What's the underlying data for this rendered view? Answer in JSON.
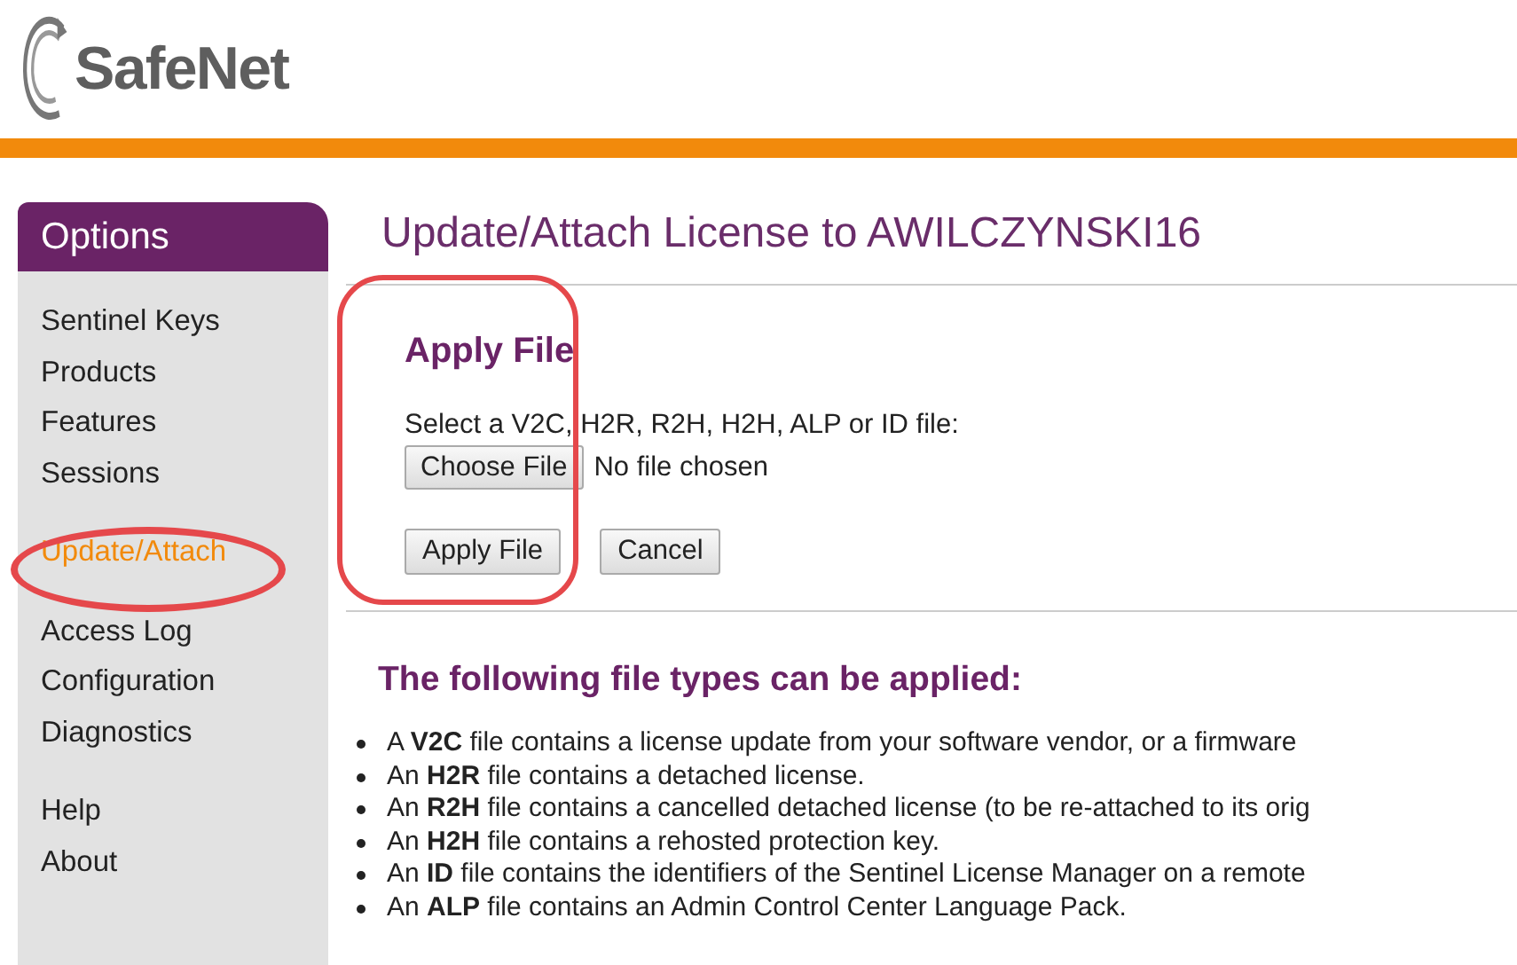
{
  "logo": {
    "text": "SafeNet"
  },
  "sidebar": {
    "title": "Options",
    "groups": [
      [
        {
          "label": "Sentinel Keys",
          "selected": false
        },
        {
          "label": "Products",
          "selected": false
        },
        {
          "label": "Features",
          "selected": false
        },
        {
          "label": "Sessions",
          "selected": false
        }
      ],
      [
        {
          "label": "Update/Attach",
          "selected": true
        }
      ],
      [
        {
          "label": "Access Log",
          "selected": false
        },
        {
          "label": "Configuration",
          "selected": false
        },
        {
          "label": "Diagnostics",
          "selected": false
        }
      ],
      [
        {
          "label": "Help",
          "selected": false
        },
        {
          "label": "About",
          "selected": false
        }
      ]
    ]
  },
  "main": {
    "title": "Update/Attach License to AWILCZYNSKI16",
    "apply": {
      "heading": "Apply File",
      "prompt": "Select a V2C, H2R, R2H, H2H, ALP or ID file:",
      "choose_button": "Choose File",
      "file_status": "No file chosen",
      "apply_button": "Apply File",
      "cancel_button": "Cancel"
    },
    "types": {
      "heading": "The following file types can be applied:",
      "items": [
        "A **V2C** file contains a license update from your software vendor, or a firmware",
        "An **H2R** file contains a detached license.",
        "An **R2H** file contains a cancelled detached license (to be re-attached to its orig",
        "An **H2H** file contains a rehosted protection key.",
        "An **ID** file contains the identifiers of the Sentinel License Manager on a remote",
        "An **ALP** file contains an Admin Control Center Language Pack."
      ]
    }
  }
}
